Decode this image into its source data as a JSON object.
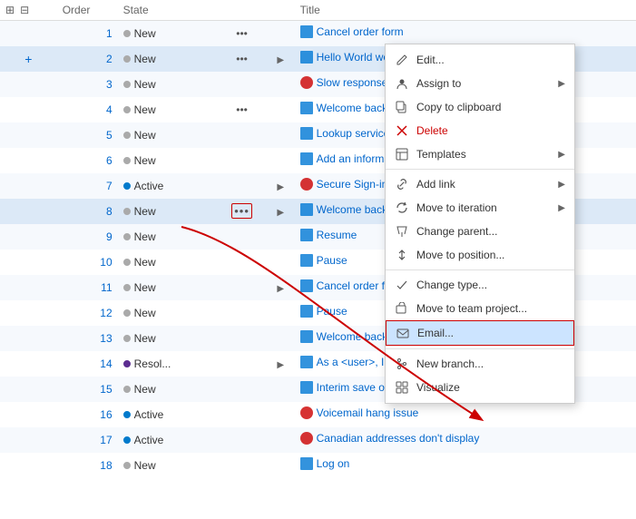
{
  "header": {
    "col_order": "Order",
    "col_state": "State",
    "col_title": "Title"
  },
  "rows": [
    {
      "id": 1,
      "order": "1",
      "state": "New",
      "state_type": "new",
      "has_dots": true,
      "has_arrow": false,
      "icon": "story",
      "title": "Cancel order form",
      "highlight": false
    },
    {
      "id": 2,
      "order": "2",
      "state": "New",
      "state_type": "new",
      "has_dots": true,
      "has_arrow": true,
      "icon": "story",
      "title": "Hello World web site",
      "highlight": true,
      "has_plus": true
    },
    {
      "id": 3,
      "order": "3",
      "state": "New",
      "state_type": "new",
      "has_dots": false,
      "has_arrow": false,
      "icon": "bug",
      "title": "Slow response on form",
      "highlight": false
    },
    {
      "id": 4,
      "order": "4",
      "state": "New",
      "state_type": "new",
      "has_dots": true,
      "has_arrow": false,
      "icon": "story",
      "title": "Welcome back page",
      "highlight": false
    },
    {
      "id": 5,
      "order": "5",
      "state": "New",
      "state_type": "new",
      "has_dots": false,
      "has_arrow": false,
      "icon": "story",
      "title": "Lookup service outages",
      "highlight": false
    },
    {
      "id": 6,
      "order": "6",
      "state": "New",
      "state_type": "new",
      "has_dots": false,
      "has_arrow": false,
      "icon": "story",
      "title": "Add an information form",
      "highlight": false
    },
    {
      "id": 7,
      "order": "7",
      "state": "Active",
      "state_type": "active",
      "has_dots": false,
      "has_arrow": true,
      "icon": "bug",
      "title": "Secure Sign-in",
      "highlight": false
    },
    {
      "id": 8,
      "order": "8",
      "state": "New",
      "state_type": "new",
      "has_dots": true,
      "has_arrow": true,
      "icon": "story",
      "title": "Welcome back",
      "highlight": true,
      "dots_highlighted": true
    },
    {
      "id": 9,
      "order": "9",
      "state": "New",
      "state_type": "new",
      "has_dots": false,
      "has_arrow": false,
      "icon": "story",
      "title": "Resume",
      "highlight": false
    },
    {
      "id": 10,
      "order": "10",
      "state": "New",
      "state_type": "new",
      "has_dots": false,
      "has_arrow": false,
      "icon": "story",
      "title": "Pause",
      "highlight": false
    },
    {
      "id": 11,
      "order": "11",
      "state": "New",
      "state_type": "new",
      "has_dots": false,
      "has_arrow": true,
      "icon": "story",
      "title": "Cancel order form",
      "highlight": false
    },
    {
      "id": 12,
      "order": "12",
      "state": "New",
      "state_type": "new",
      "has_dots": false,
      "has_arrow": false,
      "icon": "story",
      "title": "Pause",
      "highlight": false
    },
    {
      "id": 13,
      "order": "13",
      "state": "New",
      "state_type": "new",
      "has_dots": false,
      "has_arrow": false,
      "icon": "story",
      "title": "Welcome back page",
      "highlight": false
    },
    {
      "id": 14,
      "order": "14",
      "state": "Resol...",
      "state_type": "resolve",
      "has_dots": false,
      "has_arrow": true,
      "icon": "story",
      "title": "As a <user>, I can select a numbe",
      "highlight": false
    },
    {
      "id": 15,
      "order": "15",
      "state": "New",
      "state_type": "new",
      "has_dots": false,
      "has_arrow": false,
      "icon": "story",
      "title": "Interim save on long forms",
      "highlight": false
    },
    {
      "id": 16,
      "order": "16",
      "state": "Active",
      "state_type": "active",
      "has_dots": false,
      "has_arrow": false,
      "icon": "bug",
      "title": "Voicemail hang issue",
      "highlight": false
    },
    {
      "id": 17,
      "order": "17",
      "state": "Active",
      "state_type": "active",
      "has_dots": false,
      "has_arrow": false,
      "icon": "bug",
      "title": "Canadian addresses don't display",
      "highlight": false
    },
    {
      "id": 18,
      "order": "18",
      "state": "New",
      "state_type": "new",
      "has_dots": false,
      "has_arrow": false,
      "icon": "story",
      "title": "Log on",
      "highlight": false
    }
  ],
  "context_menu": {
    "items": [
      {
        "id": "edit",
        "label": "Edit...",
        "icon": "✏️",
        "has_submenu": false,
        "separator_after": false,
        "highlighted": false
      },
      {
        "id": "assign_to",
        "label": "Assign to",
        "icon": "👤",
        "has_submenu": true,
        "separator_after": false,
        "highlighted": false
      },
      {
        "id": "copy_clipboard",
        "label": "Copy to clipboard",
        "icon": "📋",
        "has_submenu": false,
        "separator_after": false,
        "highlighted": false
      },
      {
        "id": "delete",
        "label": "Delete",
        "icon": "✖",
        "has_submenu": false,
        "separator_after": false,
        "highlighted": false
      },
      {
        "id": "templates",
        "label": "Templates",
        "icon": "▤",
        "has_submenu": true,
        "separator_after": true,
        "highlighted": false
      },
      {
        "id": "add_link",
        "label": "Add link",
        "icon": "🔗",
        "has_submenu": true,
        "separator_after": false,
        "highlighted": false
      },
      {
        "id": "move_iteration",
        "label": "Move to iteration",
        "icon": "↻",
        "has_submenu": true,
        "separator_after": false,
        "highlighted": false
      },
      {
        "id": "change_parent",
        "label": "Change parent...",
        "icon": "↖",
        "has_submenu": false,
        "separator_after": false,
        "highlighted": false
      },
      {
        "id": "move_position",
        "label": "Move to position...",
        "icon": "↕",
        "has_submenu": false,
        "separator_after": true,
        "highlighted": false
      },
      {
        "id": "change_type",
        "label": "Change type...",
        "icon": "⇄",
        "has_submenu": false,
        "separator_after": false,
        "highlighted": false
      },
      {
        "id": "move_team",
        "label": "Move to team project...",
        "icon": "📁",
        "has_submenu": false,
        "separator_after": false,
        "highlighted": false
      },
      {
        "id": "email",
        "label": "Email...",
        "icon": "✉",
        "has_submenu": false,
        "separator_after": true,
        "highlighted": true
      },
      {
        "id": "new_branch",
        "label": "New branch...",
        "icon": "⑂",
        "has_submenu": false,
        "separator_after": false,
        "highlighted": false
      },
      {
        "id": "visualize",
        "label": "Visualize",
        "icon": "⊞",
        "has_submenu": false,
        "separator_after": false,
        "highlighted": false
      }
    ]
  },
  "icons": {
    "story": "📘",
    "bug": "🐛",
    "pencil": "✏",
    "person": "👤",
    "clipboard": "📋",
    "x": "✖",
    "template": "▤",
    "link": "🔗",
    "refresh": "↻",
    "arrow_upper_left": "↖",
    "updown": "↕",
    "swap": "⇄",
    "folder": "📁",
    "email": "✉",
    "branch": "⑂",
    "grid": "⊞"
  },
  "colors": {
    "link": "#0066cc",
    "accent": "#0078d4",
    "highlight_row": "#dce9f7",
    "menu_highlight": "#cce4ff",
    "red_border": "#cc0000",
    "dot_new": "#aaaaaa",
    "dot_active": "#007acc",
    "dot_resolve": "#5c2d91"
  }
}
